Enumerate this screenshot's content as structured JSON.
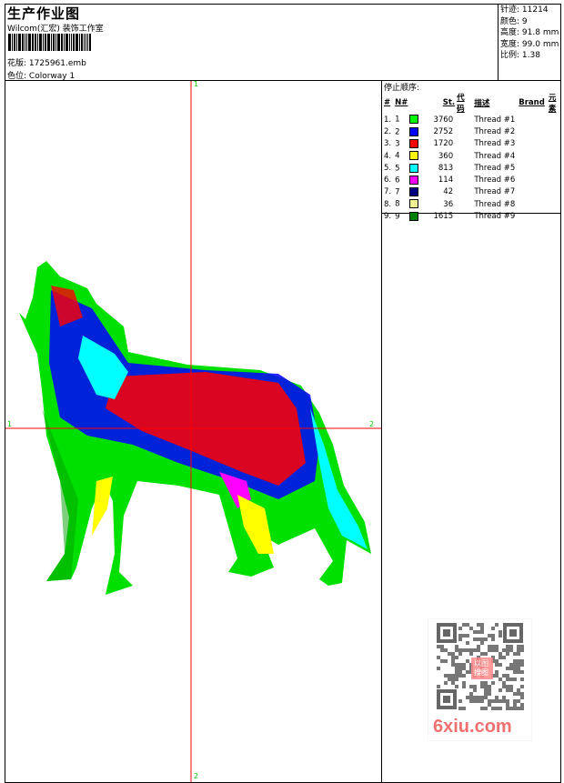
{
  "header": {
    "title": "生产作业图",
    "company": "Wilcom(汇宏) 装饰工作室",
    "design_label": "花版:",
    "design_value": "1725961.emb",
    "colorway_label": "色位:",
    "colorway_value": "Colorway 1"
  },
  "stats": {
    "stitches_label": "针迹:",
    "stitches": "11214",
    "colors_label": "颜色:",
    "colors": "9",
    "height_label": "高度:",
    "height": "91.8 mm",
    "width_label": "宽度:",
    "width": "99.0 mm",
    "ratio_label": "比例:",
    "ratio": "1.38"
  },
  "stop_sequence": {
    "title": "停止顺序:",
    "headers": [
      "#",
      "N#",
      "St.",
      "代码",
      "描述",
      "Brand",
      "元素"
    ],
    "rows": [
      {
        "idx": "1.",
        "n": "1",
        "color": "#00ff00",
        "st": "3760",
        "desc": "Thread #1"
      },
      {
        "idx": "2.",
        "n": "2",
        "color": "#0000ff",
        "st": "2752",
        "desc": "Thread #2"
      },
      {
        "idx": "3.",
        "n": "3",
        "color": "#ff0000",
        "st": "1720",
        "desc": "Thread #3"
      },
      {
        "idx": "4.",
        "n": "4",
        "color": "#ffff00",
        "st": "360",
        "desc": "Thread #4"
      },
      {
        "idx": "5.",
        "n": "5",
        "color": "#00ffff",
        "st": "813",
        "desc": "Thread #5"
      },
      {
        "idx": "6.",
        "n": "6",
        "color": "#ff00ff",
        "st": "114",
        "desc": "Thread #6"
      },
      {
        "idx": "7.",
        "n": "7",
        "color": "#000080",
        "st": "42",
        "desc": "Thread #7"
      },
      {
        "idx": "8.",
        "n": "8",
        "color": "#f0f090",
        "st": "36",
        "desc": "Thread #8"
      },
      {
        "idx": "9.",
        "n": "9",
        "color": "#008000",
        "st": "1615",
        "desc": "Thread #9"
      }
    ]
  },
  "axes": {
    "top": "1",
    "bottom": "2",
    "left": "1",
    "right": "2"
  },
  "watermark": {
    "text": "6xiu.com",
    "stamp": "以图搜图"
  }
}
